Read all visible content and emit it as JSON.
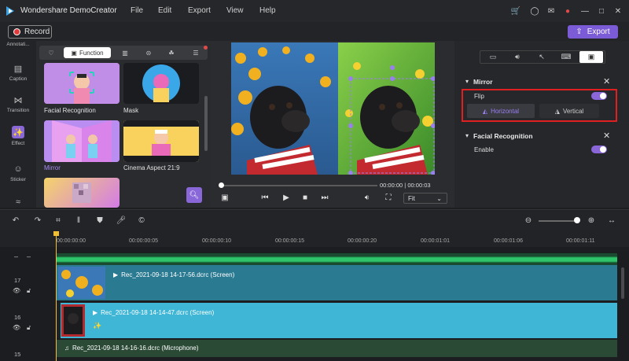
{
  "app": {
    "title": "Wondershare DemoCreator"
  },
  "menu": [
    "File",
    "Edit",
    "Export",
    "View",
    "Help"
  ],
  "toolbar": {
    "record_label": "Record",
    "export_label": "Export"
  },
  "sidebar": {
    "items": [
      {
        "label": "Annotati..."
      },
      {
        "label": "Caption"
      },
      {
        "label": "Transition"
      },
      {
        "label": "Effect"
      },
      {
        "label": "Sticker"
      }
    ]
  },
  "library": {
    "active_tab": "Function",
    "items": [
      {
        "label": "Facial Recognition"
      },
      {
        "label": "Mask"
      },
      {
        "label": "Mirror"
      },
      {
        "label": "Cinema Aspect 21:9"
      }
    ]
  },
  "preview": {
    "time_current": "00:00:00",
    "time_total": "00:00:03",
    "time_sep": "|",
    "fit_label": "Fit",
    "progress": 0.0
  },
  "properties": {
    "mirror": {
      "title": "Mirror",
      "flip_label": "Flip",
      "flip_on": true,
      "horizontal_label": "Horizontal",
      "vertical_label": "Vertical"
    },
    "facial": {
      "title": "Facial Recognition",
      "enable_label": "Enable",
      "enable_on": true
    }
  },
  "timeline": {
    "ruler": [
      "00:00:00:00",
      "00:00:00:05",
      "00:00:00:10",
      "00:00:00:15",
      "00:00:00:20",
      "00:00:01:01",
      "00:00:01:06",
      "00:00:01:11"
    ],
    "zoom_level": 0.9,
    "tracks": [
      {
        "num": "17",
        "clip": "Rec_2021-09-18 14-17-56.dcrc (Screen)"
      },
      {
        "num": "16",
        "clip": "Rec_2021-09-18 14-14-47.dcrc (Screen)"
      },
      {
        "num": "15",
        "clip": "Rec_2021-09-18 14-16-16.dcrc (Microphone)"
      }
    ]
  },
  "colors": {
    "accent": "#7c5bd6",
    "highlight": "#e02020",
    "track_screen_a": "#2a7a92",
    "track_screen_b": "#3fb6d6",
    "track_audio": "#2a4a36"
  }
}
